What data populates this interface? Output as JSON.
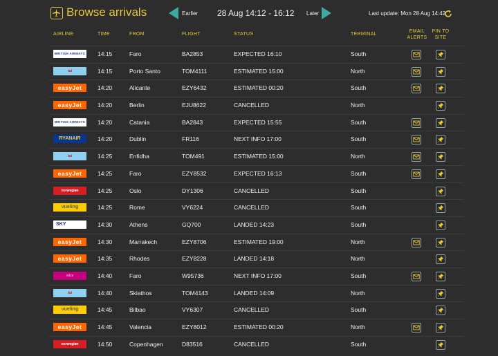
{
  "header": {
    "title": "Browse arrivals",
    "earlier_label": "Earlier",
    "date_range": "28 Aug  14:12 - 16:12",
    "later_label": "Later",
    "last_update": "Last update: Mon 28 Aug 14:42"
  },
  "columns": {
    "airline": "AIRLINE",
    "time": "TIME",
    "from": "FROM",
    "flight": "FLIGHT",
    "status": "STATUS",
    "terminal": "TERMINAL",
    "email_line1": "EMAIL",
    "email_line2": "ALERTS",
    "pin_line1": "PIN TO",
    "pin_line2": "SITE"
  },
  "colors": {
    "accent": "#e8c83a",
    "arrow": "#3fa9a0",
    "background": "#2d2d2d"
  },
  "rows": [
    {
      "airline_logo": "BRITISH AIRWAYS",
      "logo_class": "ba",
      "time": "14:15",
      "from": "Faro",
      "flight": "BA2853",
      "status": "EXPECTED 16:10",
      "terminal": "South",
      "email": true
    },
    {
      "airline_logo": "tui",
      "logo_class": "tui",
      "time": "14:15",
      "from": "Porto Santo",
      "flight": "TOM4111",
      "status": "ESTIMATED 15:00",
      "terminal": "North",
      "email": true
    },
    {
      "airline_logo": "easyJet",
      "logo_class": "easyjet",
      "time": "14:20",
      "from": "Alicante",
      "flight": "EZY6432",
      "status": "ESTIMATED 00:20",
      "terminal": "South",
      "email": true
    },
    {
      "airline_logo": "easyJet",
      "logo_class": "easyjet",
      "time": "14:20",
      "from": "Berlin",
      "flight": "EJU8622",
      "status": "CANCELLED",
      "terminal": "North",
      "email": false
    },
    {
      "airline_logo": "BRITISH AIRWAYS",
      "logo_class": "ba",
      "time": "14:20",
      "from": "Catania",
      "flight": "BA2843",
      "status": "EXPECTED 15:55",
      "terminal": "South",
      "email": true
    },
    {
      "airline_logo": "RYANAIR",
      "logo_class": "ryanair",
      "time": "14:20",
      "from": "Dublin",
      "flight": "FR116",
      "status": "NEXT INFO 17:00",
      "terminal": "South",
      "email": true
    },
    {
      "airline_logo": "tui",
      "logo_class": "tui",
      "time": "14:25",
      "from": "Enfidha",
      "flight": "TOM491",
      "status": "ESTIMATED 15:00",
      "terminal": "North",
      "email": true
    },
    {
      "airline_logo": "easyJet",
      "logo_class": "easyjet",
      "time": "14:25",
      "from": "Faro",
      "flight": "EZY8532",
      "status": "EXPECTED 16:13",
      "terminal": "South",
      "email": true
    },
    {
      "airline_logo": "norwegian",
      "logo_class": "norwegian",
      "time": "14:25",
      "from": "Oslo",
      "flight": "DY1306",
      "status": "CANCELLED",
      "terminal": "South",
      "email": false
    },
    {
      "airline_logo": "vueling",
      "logo_class": "vueling",
      "time": "14:25",
      "from": "Rome",
      "flight": "VY6224",
      "status": "CANCELLED",
      "terminal": "South",
      "email": false
    },
    {
      "airline_logo": "SKY",
      "logo_class": "sky",
      "time": "14:30",
      "from": "Athens",
      "flight": "GQ700",
      "status": "LANDED 14:23",
      "terminal": "South",
      "email": false
    },
    {
      "airline_logo": "easyJet",
      "logo_class": "easyjet",
      "time": "14:30",
      "from": "Marrakech",
      "flight": "EZY8706",
      "status": "ESTIMATED 19:00",
      "terminal": "North",
      "email": true
    },
    {
      "airline_logo": "easyJet",
      "logo_class": "easyjet",
      "time": "14:35",
      "from": "Rhodes",
      "flight": "EZY8228",
      "status": "LANDED 14:18",
      "terminal": "North",
      "email": false
    },
    {
      "airline_logo": "wizz",
      "logo_class": "wizz",
      "time": "14:40",
      "from": "Faro",
      "flight": "W95736",
      "status": "NEXT INFO 17:00",
      "terminal": "South",
      "email": true
    },
    {
      "airline_logo": "tui",
      "logo_class": "tui",
      "time": "14:40",
      "from": "Skiathos",
      "flight": "TOM4143",
      "status": "LANDED 14:09",
      "terminal": "North",
      "email": false
    },
    {
      "airline_logo": "vueling",
      "logo_class": "vueling",
      "time": "14:45",
      "from": "Bilbao",
      "flight": "VY6307",
      "status": "CANCELLED",
      "terminal": "South",
      "email": false
    },
    {
      "airline_logo": "easyJet",
      "logo_class": "easyjet",
      "time": "14:45",
      "from": "Valencia",
      "flight": "EZY8012",
      "status": "ESTIMATED 00:20",
      "terminal": "North",
      "email": true
    },
    {
      "airline_logo": "norwegian",
      "logo_class": "norwegian",
      "time": "14:50",
      "from": "Copenhagen",
      "flight": "D83516",
      "status": "CANCELLED",
      "terminal": "South",
      "email": false
    }
  ]
}
